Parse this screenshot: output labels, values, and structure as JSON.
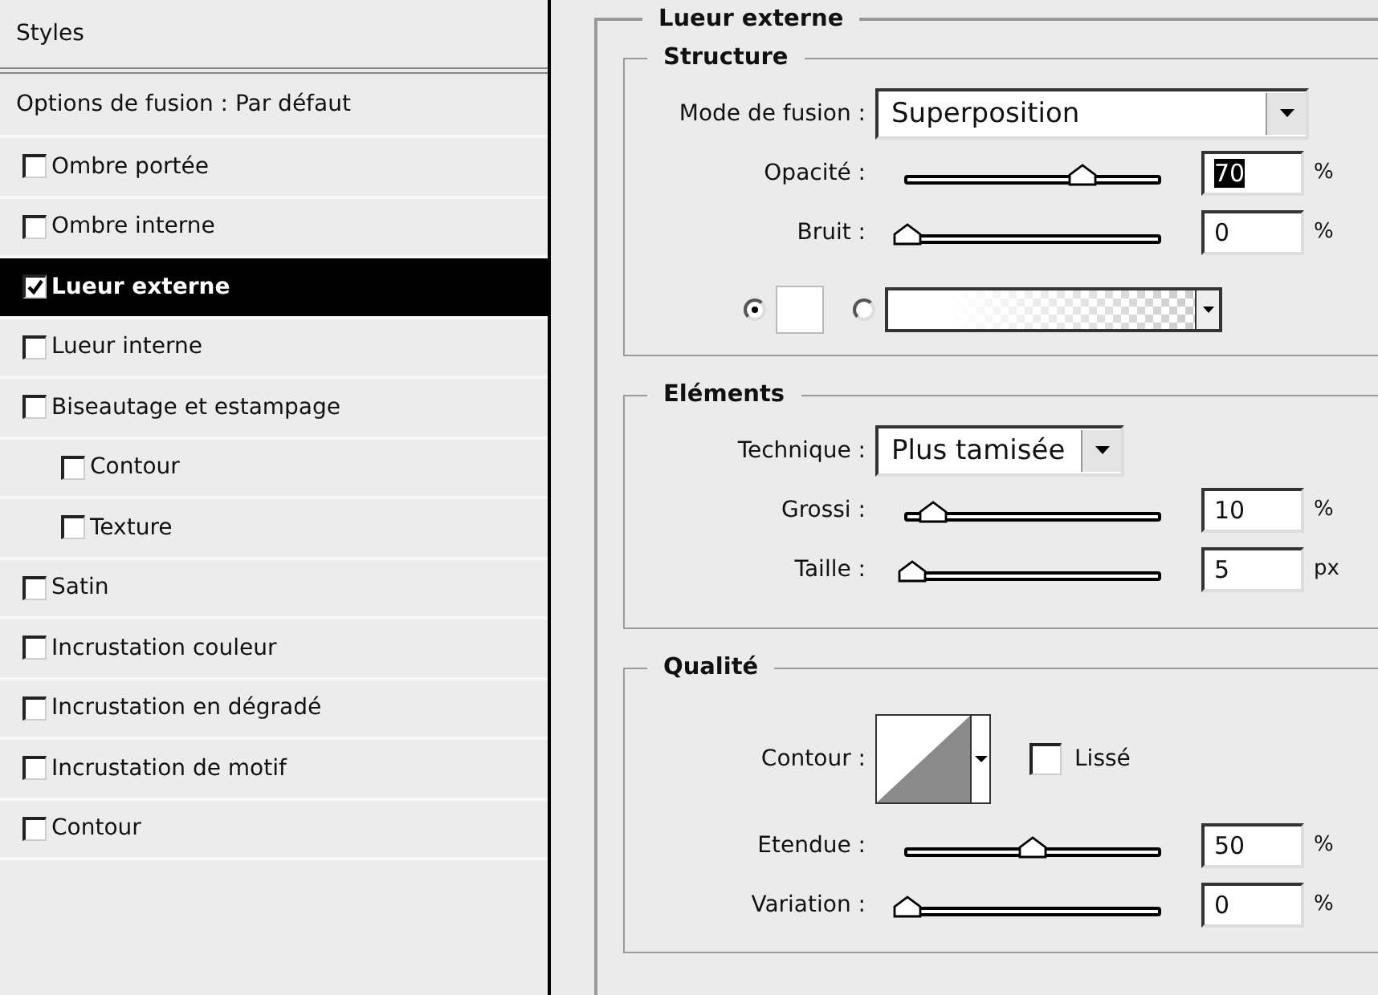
{
  "sidebar": {
    "header": "Styles",
    "blend_options": "Options de fusion : Par défaut",
    "items": [
      {
        "label": "Ombre portée",
        "checked": false,
        "selected": false
      },
      {
        "label": "Ombre interne",
        "checked": false,
        "selected": false
      },
      {
        "label": "Lueur externe",
        "checked": true,
        "selected": true
      },
      {
        "label": "Lueur interne",
        "checked": false,
        "selected": false
      },
      {
        "label": "Biseautage et estampage",
        "checked": false,
        "selected": false,
        "children": [
          {
            "label": "Contour",
            "checked": false,
            "selected": false
          },
          {
            "label": "Texture",
            "checked": false,
            "selected": false
          }
        ]
      },
      {
        "label": "Satin",
        "checked": false,
        "selected": false
      },
      {
        "label": "Incrustation couleur",
        "checked": false,
        "selected": false
      },
      {
        "label": "Incrustation en dégradé",
        "checked": false,
        "selected": false
      },
      {
        "label": "Incrustation de motif",
        "checked": false,
        "selected": false
      },
      {
        "label": "Contour",
        "checked": false,
        "selected": false
      }
    ]
  },
  "panel": {
    "title": "Lueur externe",
    "sections": [
      {
        "title": "Structure",
        "rows": [
          {
            "kind": "select",
            "label": "Mode de fusion :",
            "value": "Superposition"
          },
          {
            "kind": "slider",
            "label": "Opacité :",
            "level": 0.7,
            "value": "70",
            "unit": "%",
            "value_selected": true
          },
          {
            "kind": "slider",
            "label": "Bruit :",
            "level": 0,
            "value": "0",
            "unit": "%",
            "value_selected": false
          },
          {
            "kind": "fill",
            "options": [
              {
                "kind": "color",
                "selected": true
              },
              {
                "kind": "gradient",
                "selected": false
              }
            ]
          }
        ]
      },
      {
        "title": "Eléments",
        "rows": [
          {
            "kind": "select",
            "label": "Technique :",
            "value": "Plus tamisée"
          },
          {
            "kind": "slider",
            "label": "Grossi :",
            "level": 0.1,
            "value": "10",
            "unit": "%",
            "value_selected": false
          },
          {
            "kind": "slider",
            "label": "Taille :",
            "level": 0.02,
            "value": "5",
            "unit": "px",
            "value_selected": false
          }
        ]
      },
      {
        "title": "Qualité",
        "rows": [
          {
            "kind": "contour",
            "label": "Contour :",
            "checkbox": {
              "label": "Lissé",
              "checked": false
            }
          },
          {
            "kind": "slider",
            "label": "Etendue :",
            "level": 0.5,
            "value": "50",
            "unit": "%",
            "value_selected": false
          },
          {
            "kind": "slider",
            "label": "Variation :",
            "level": 0,
            "value": "0",
            "unit": "%",
            "value_selected": false
          }
        ]
      }
    ]
  }
}
